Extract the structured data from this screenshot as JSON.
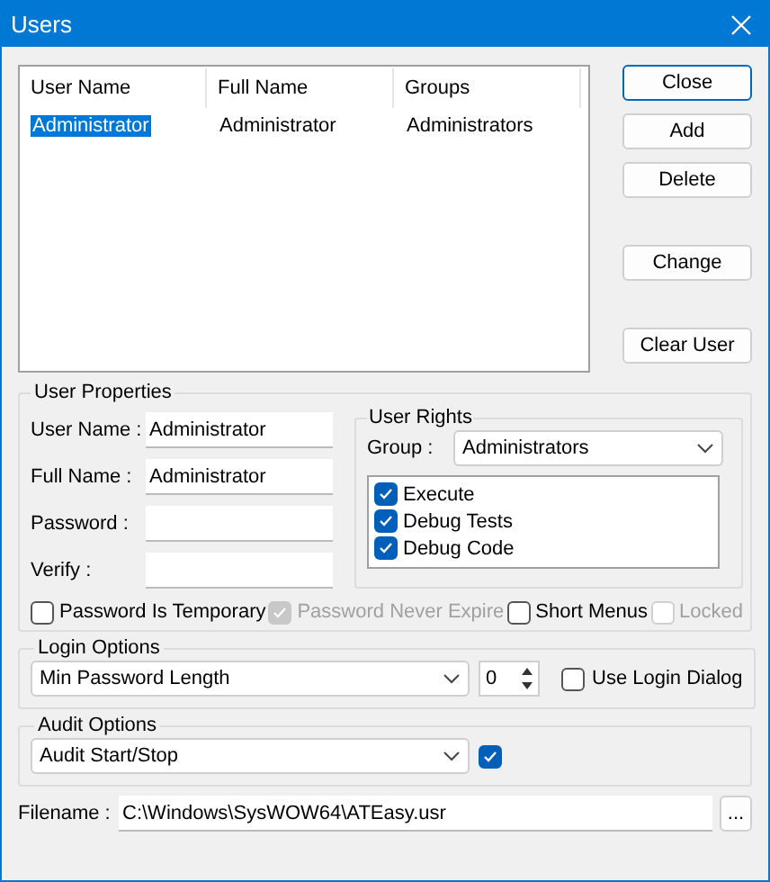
{
  "window": {
    "title": "Users"
  },
  "users_table": {
    "columns": [
      "User Name",
      "Full Name",
      "Groups"
    ],
    "rows": [
      {
        "cells": [
          "Administrator",
          "Administrator",
          "Administrators"
        ],
        "selected": true
      }
    ]
  },
  "buttons": [
    {
      "label": "Close",
      "default": true
    },
    {
      "label": "Add",
      "default": false
    },
    {
      "label": "Delete",
      "default": false
    },
    {
      "label": "Change",
      "default": false
    },
    {
      "label": "Clear User",
      "default": false
    }
  ],
  "user_properties": {
    "title": "User Properties",
    "fields": [
      {
        "label": "User Name :",
        "value": "Administrator"
      },
      {
        "label": "Full Name :",
        "value": "Administrator"
      },
      {
        "label": "Password :"
      },
      {
        "label": "Verify :"
      }
    ]
  },
  "user_rights": {
    "title": "User Rights",
    "group_label": "Group :",
    "group_value": "Administrators",
    "rights": [
      {
        "label": "Execute",
        "checked": true
      },
      {
        "label": "Debug Tests",
        "checked": true
      },
      {
        "label": "Debug Code",
        "checked": true
      }
    ]
  },
  "options": [
    {
      "label": "Password Is Temporary",
      "checked": false,
      "disabled": false
    },
    {
      "label": "Password Never Expire",
      "checked": true,
      "disabled": true
    },
    {
      "label": "Short Menus",
      "checked": false,
      "disabled": false
    },
    {
      "label": "Locked",
      "checked": false,
      "disabled": true
    }
  ],
  "login_options": {
    "title": "Login Options",
    "setting": "Min Password Length",
    "value": "0",
    "use_login_dialog": {
      "label": "Use Login Dialog",
      "checked": false
    }
  },
  "audit_options": {
    "title": "Audit Options",
    "setting": "Audit Start/Stop",
    "checked": true
  },
  "filename": {
    "label": "Filename :",
    "value": "C:\\Windows\\SysWOW64\\ATEasy.usr",
    "browse": "..."
  }
}
